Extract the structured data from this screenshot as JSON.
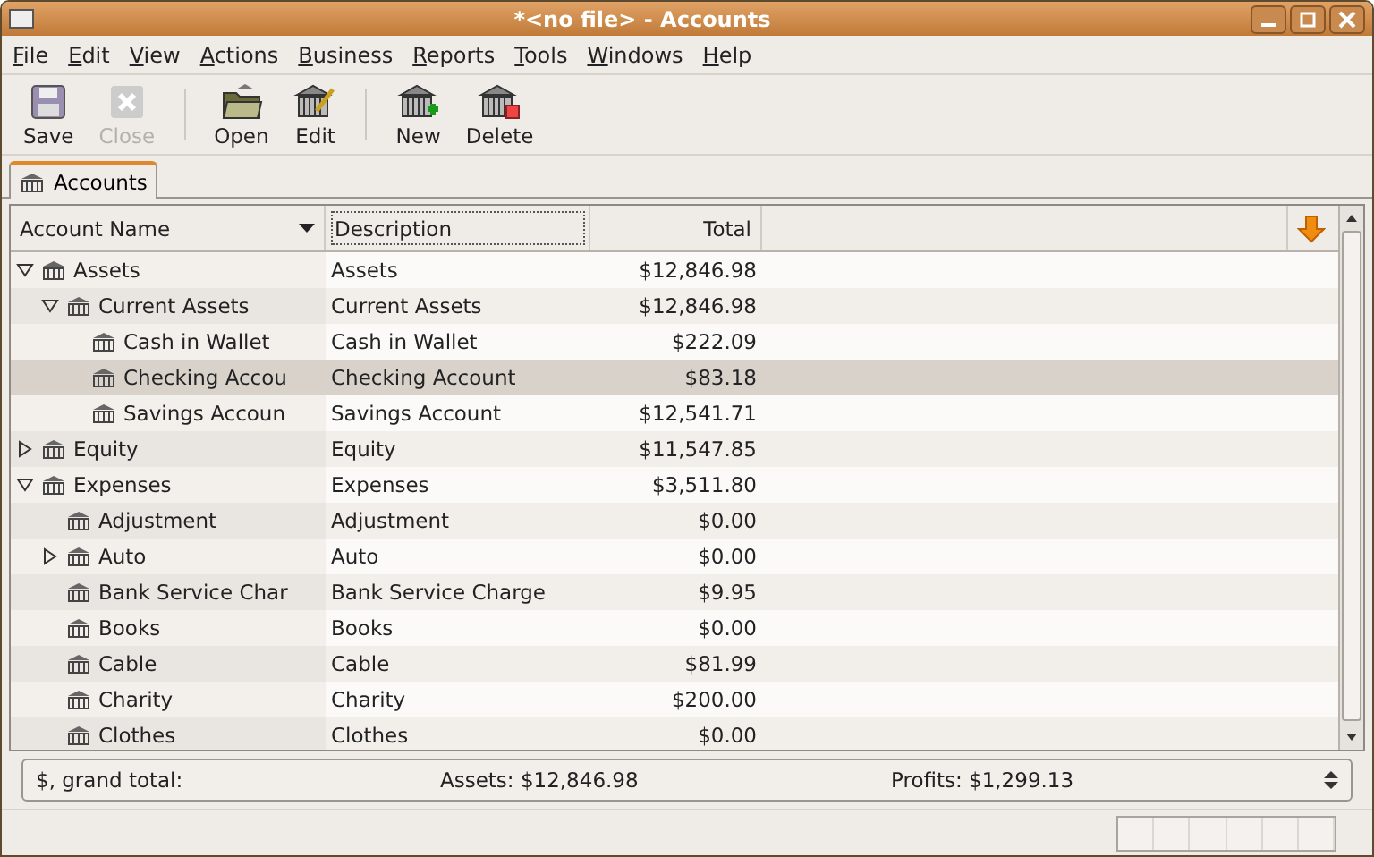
{
  "window": {
    "title": "*<no file> - Accounts"
  },
  "menu": [
    "File",
    "Edit",
    "View",
    "Actions",
    "Business",
    "Reports",
    "Tools",
    "Windows",
    "Help"
  ],
  "toolbar": [
    {
      "label": "Save",
      "kind": "save",
      "disabled": false
    },
    {
      "label": "Close",
      "kind": "close",
      "disabled": true
    },
    {
      "kind": "separator"
    },
    {
      "label": "Open",
      "kind": "open",
      "disabled": false
    },
    {
      "label": "Edit",
      "kind": "edit",
      "disabled": false
    },
    {
      "kind": "separator"
    },
    {
      "label": "New",
      "kind": "new",
      "disabled": false
    },
    {
      "label": "Delete",
      "kind": "delete",
      "disabled": false
    }
  ],
  "tabs": [
    {
      "label": "Accounts",
      "selected": true
    }
  ],
  "table": {
    "columns": [
      "Account Name",
      "Description",
      "Total"
    ],
    "rows": [
      {
        "name": "Assets",
        "description": "Assets",
        "total": "$12,846.98",
        "selected": false,
        "expanded": true,
        "children": [
          {
            "name": "Current Assets",
            "description": "Current Assets",
            "total": "$12,846.98",
            "selected": false,
            "expanded": true,
            "children": [
              {
                "name": "Cash in Wallet",
                "description": "Cash in Wallet",
                "total": "$222.09",
                "selected": false
              },
              {
                "name": "Checking Accou",
                "description": "Checking Account",
                "total": "$83.18",
                "selected": true
              },
              {
                "name": "Savings Accoun",
                "description": "Savings Account",
                "total": "$12,541.71",
                "selected": false
              }
            ]
          }
        ]
      },
      {
        "name": "Equity",
        "description": "Equity",
        "total": "$11,547.85",
        "selected": false,
        "expanded": false
      },
      {
        "name": "Expenses",
        "description": "Expenses",
        "total": "$3,511.80",
        "selected": false,
        "expanded": true,
        "children": [
          {
            "name": "Adjustment",
            "description": "Adjustment",
            "total": "$0.00",
            "selected": false
          },
          {
            "name": "Auto",
            "description": "Auto",
            "total": "$0.00",
            "selected": false,
            "expanded": false
          },
          {
            "name": "Bank Service Char",
            "description": "Bank Service Charge",
            "total": "$9.95",
            "selected": false
          },
          {
            "name": "Books",
            "description": "Books",
            "total": "$0.00",
            "selected": false
          },
          {
            "name": "Cable",
            "description": "Cable",
            "total": "$81.99",
            "selected": false
          },
          {
            "name": "Charity",
            "description": "Charity",
            "total": "$200.00",
            "selected": false
          },
          {
            "name": "Clothes",
            "description": "Clothes",
            "total": "$0.00",
            "selected": false
          }
        ]
      }
    ]
  },
  "summary": {
    "label": "$, grand total:",
    "assets": "Assets: $12,846.98",
    "profits": "Profits: $1,299.13"
  }
}
